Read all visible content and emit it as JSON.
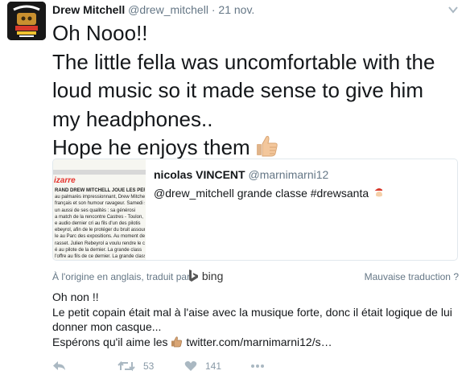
{
  "author": {
    "name": "Drew Mitchell",
    "handle": "@drew_mitchell",
    "separator": "·",
    "date": "21 nov."
  },
  "tweet": {
    "lines": [
      "Oh Nooo!!",
      "The little fella was uncomfortable with the",
      "loud music so it made sense to give him",
      "my headphones..",
      "Hope he enjoys them"
    ],
    "emoji": "thumbs-up-icon"
  },
  "quoted": {
    "name": "nicolas VINCENT",
    "handle": "@marnimarni12",
    "text": "@drew_mitchell grande classe #drewsanta",
    "emoji": "santa-icon",
    "image": {
      "brand": "izarre",
      "lines": [
        "RAND DREW MITCHELL JOUE LES PÈRES N",
        "au palmarès impressionnant, Drew Mitche",
        "français et son humour ravageur. Samedi so",
        "un aussi de ses qualités : sa générosi",
        "a match de la rencontre Castres - Toulon, le",
        "e audio dernier cri au fils d'un des pilotis",
        "ebeyrol, afin de le protéger du bruit assourdi",
        "le au Parc des expositions. Au moment de voi",
        "rasset. Julien Rebeyrol a voulu rendre le casque",
        "é au pilote de la dernier. La grande class",
        "l'offre au fils de ce dernier. La grande class"
      ]
    }
  },
  "translation": {
    "origin_label": "À l'origine en anglais, traduit par",
    "provider": "bing",
    "bad_translation": "Mauvaise traduction ?",
    "lines": [
      "Oh non !!",
      "Le petit copain était mal à l'aise avec la musique forte, donc il était logique de lui",
      "donner mon casque...",
      "Espérons qu'il aime les"
    ],
    "link": "twitter.com/marnimarni12/s…"
  },
  "actions": {
    "retweets": "53",
    "likes": "141"
  }
}
